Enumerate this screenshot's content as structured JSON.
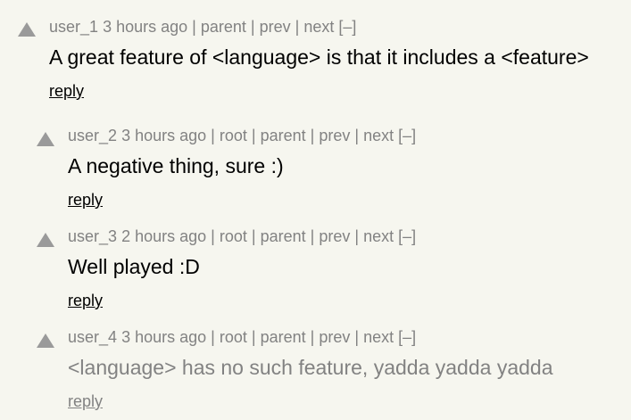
{
  "comments": [
    {
      "user": "user_1",
      "age": "3 hours ago",
      "links": [
        "parent",
        "prev",
        "next"
      ],
      "toggle": "[–]",
      "text": "A great feature of <language> is that it includes a <feature>",
      "reply": "reply",
      "downvoted": false
    },
    {
      "user": "user_2",
      "age": "3 hours ago",
      "links": [
        "root",
        "parent",
        "prev",
        "next"
      ],
      "toggle": "[–]",
      "text": "A negative thing, sure :)",
      "reply": "reply",
      "downvoted": false
    },
    {
      "user": "user_3",
      "age": "2 hours ago",
      "links": [
        "root",
        "parent",
        "prev",
        "next"
      ],
      "toggle": "[–]",
      "text": "Well played :D",
      "reply": "reply",
      "downvoted": false
    },
    {
      "user": "user_4",
      "age": "3 hours ago",
      "links": [
        "root",
        "parent",
        "prev",
        "next"
      ],
      "toggle": "[–]",
      "text": "<language> has no such feature, yadda yadda yadda",
      "reply": "reply",
      "downvoted": true
    }
  ],
  "colors": {
    "background": "#f6f6ef",
    "meta": "#828282",
    "text": "#000000",
    "vote_arrow": "#9a9a9a"
  },
  "icons": {
    "vote": "upvote-arrow-icon"
  }
}
